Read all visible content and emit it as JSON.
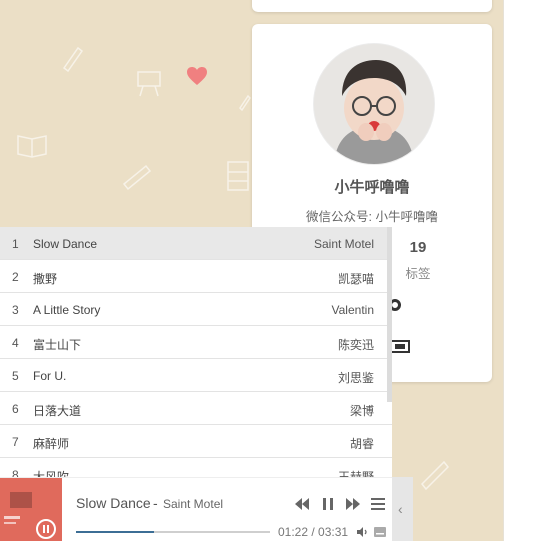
{
  "profile": {
    "name": "小牛呼噜噜",
    "desc": "微信公众号: 小牛呼噜噜",
    "stat_number": "19",
    "stat_label": "标签"
  },
  "playlist": {
    "tracks": [
      {
        "num": "1",
        "title": "Slow Dance",
        "artist": "Saint Motel"
      },
      {
        "num": "2",
        "title": "撒野",
        "artist": "凯瑟喵"
      },
      {
        "num": "3",
        "title": "A Little Story",
        "artist": "Valentin"
      },
      {
        "num": "4",
        "title": "富士山下",
        "artist": "陈奕迅"
      },
      {
        "num": "5",
        "title": "For U.",
        "artist": "刘思鉴"
      },
      {
        "num": "6",
        "title": "日落大道",
        "artist": "梁博"
      },
      {
        "num": "7",
        "title": "麻醉师",
        "artist": "胡睿"
      },
      {
        "num": "8",
        "title": "大风吹",
        "artist": "王赫野"
      }
    ],
    "active_index": 0
  },
  "player": {
    "title": "Slow Dance",
    "separator": "-",
    "artist": "Saint Motel",
    "time": "01:22 / 03:31",
    "progress": 0.4
  },
  "colors": {
    "background": "#ebdfc6",
    "accent_heart": "#f08080",
    "progress_fill": "#3c6e95",
    "cover": "#e06a5c"
  },
  "icons": [
    "heart-icon",
    "prev-icon",
    "pause-icon",
    "next-icon",
    "menu-icon",
    "volume-icon",
    "lyrics-icon",
    "collapse-chevron-icon"
  ]
}
